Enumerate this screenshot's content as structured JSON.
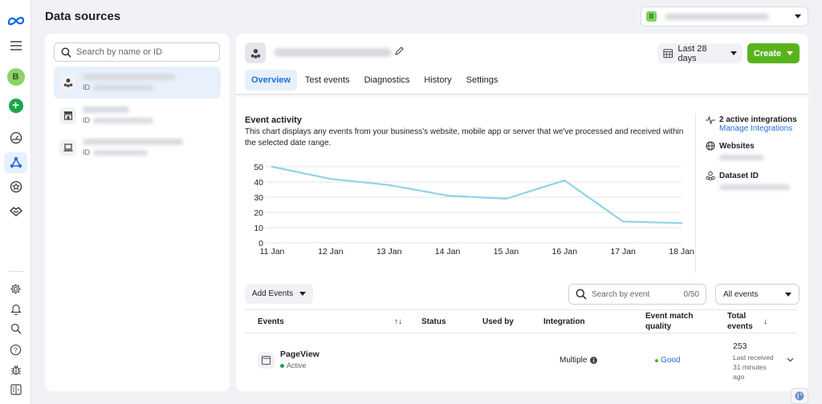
{
  "app": {
    "title": "Data sources",
    "brand_color": "#0668e1",
    "account_selector": {
      "badge_letter": "B"
    }
  },
  "rail": {
    "avatar_letter": "B",
    "top_items": [
      {
        "icon": "meta-logo-icon"
      },
      {
        "icon": "menu-icon"
      },
      {
        "icon": "avatar"
      },
      {
        "icon": "create-plus-icon"
      },
      {
        "icon": "dashboard-gauge-icon"
      },
      {
        "icon": "data-sources-icon",
        "active": true
      },
      {
        "icon": "star-badge-icon"
      },
      {
        "icon": "partner-handshake-icon"
      }
    ],
    "bottom_items": [
      {
        "icon": "settings-gear-icon"
      },
      {
        "icon": "notifications-bell-icon"
      },
      {
        "icon": "search-icon"
      },
      {
        "icon": "help-icon"
      },
      {
        "icon": "bug-report-icon"
      },
      {
        "icon": "panel-toggle-icon"
      }
    ]
  },
  "sources": {
    "search_placeholder": "Search by name or ID",
    "id_label": "ID",
    "items": [
      {
        "icon": "dataset-icon",
        "selected": true
      },
      {
        "icon": "store-icon",
        "selected": false
      },
      {
        "icon": "laptop-icon",
        "selected": false
      }
    ]
  },
  "main": {
    "tabs": [
      {
        "label": "Overview",
        "active": true
      },
      {
        "label": "Test events"
      },
      {
        "label": "Diagnostics"
      },
      {
        "label": "History"
      },
      {
        "label": "Settings"
      }
    ],
    "date_range": "Last 28 days",
    "create_label": "Create",
    "activity": {
      "title": "Event activity",
      "description": "This chart displays any events from your business's website, mobile app or server that we've processed and received within the selected date range."
    },
    "side_info": {
      "integrations": "2 active integrations",
      "manage_link": "Manage Integrations",
      "websites": "Websites",
      "dataset_id": "Dataset ID"
    },
    "events": {
      "add_label": "Add Events",
      "search_placeholder": "Search by event",
      "search_count": "0/50",
      "filter_value": "All events",
      "columns": {
        "events": "Events",
        "sort": "↑↓",
        "status": "Status",
        "used_by": "Used by",
        "integration": "Integration",
        "match_quality": "Event match quality",
        "total": "Total events",
        "total_sort": "↓"
      },
      "rows": [
        {
          "name": "PageView",
          "status": "Active",
          "integration": "Multiple",
          "match_quality": "Good",
          "total": "253",
          "last_received": "Last received 31 minutes ago"
        }
      ]
    }
  },
  "chart_data": {
    "type": "line",
    "title": "Event activity",
    "categories": [
      "11 Jan",
      "12 Jan",
      "13 Jan",
      "14 Jan",
      "15 Jan",
      "16 Jan",
      "17 Jan",
      "18 Jan"
    ],
    "series": [
      {
        "name": "Events",
        "values": [
          50,
          42,
          38,
          31,
          29,
          41,
          14,
          13
        ],
        "color": "#8fd3ea"
      }
    ],
    "yticks": [
      0,
      10,
      20,
      30,
      40,
      50
    ],
    "ylim": [
      0,
      50
    ],
    "xlabel": "",
    "ylabel": "",
    "grid": true,
    "legend": "none"
  }
}
